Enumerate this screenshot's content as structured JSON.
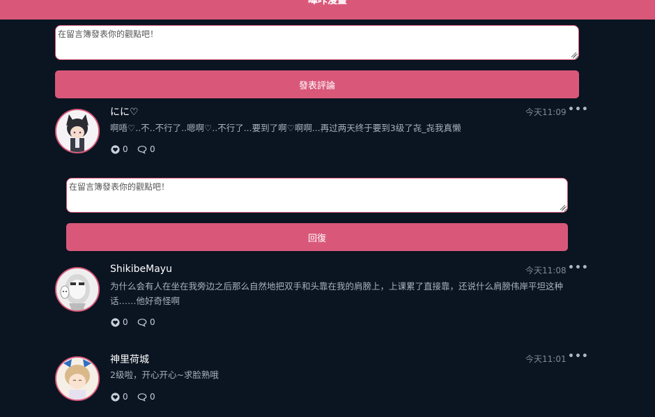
{
  "header": {
    "title": "嗶咔漫畫"
  },
  "composer": {
    "placeholder": "在留言簿發表你的觀點吧！",
    "submit_label": "發表評論"
  },
  "reply_box": {
    "placeholder": "在留言簿發表你的觀點吧！",
    "submit_label": "回復"
  },
  "comments": [
    {
      "name": "にに♡",
      "time": "今天11:09",
      "content": "啊唔♡..不..不行了..嗯啊♡..不行了...要到了啊♡啊啊...再过两天终于要到3级了㐂_㐂我真懒",
      "likes": "0",
      "replies": "0"
    },
    {
      "name": "ShikibeMayu",
      "time": "今天11:08",
      "content_line1": "为什么会有人在坐在我旁边之后那么自然地把双手和头靠在我的肩膀上，上课累了直接靠，还说什么肩膀伟岸平坦这种",
      "content_line2": "话……他好奇怪啊",
      "likes": "0",
      "replies": "0"
    },
    {
      "name": "神里荷城",
      "time": "今天11:01",
      "content": "2级啦，开心开心~求脸熟哦",
      "likes": "0",
      "replies": "0"
    }
  ],
  "icons": {
    "more": "more-dots-icon",
    "like": "heart-icon",
    "reply": "comment-bubble-icon"
  },
  "colors": {
    "accent": "#d9587a",
    "background": "#0b1421"
  }
}
